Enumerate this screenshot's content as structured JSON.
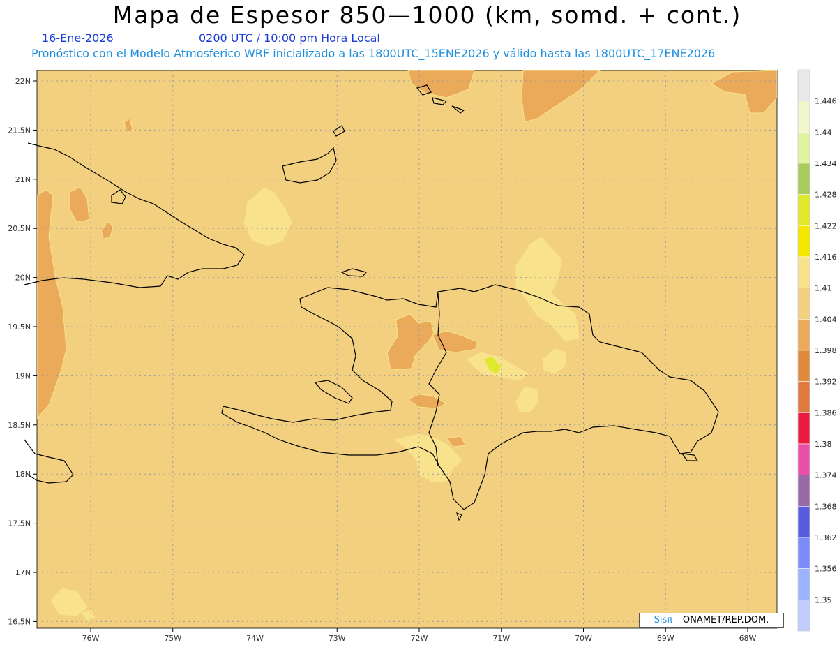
{
  "header": {
    "title": "Mapa de Espesor 850—1000 (km, somd. + cont.)",
    "date": "16-Ene-2026",
    "time": "0200 UTC / 10:00 pm Hora Local",
    "forecast": "Pronóstico con el Modelo Atmosferico WRF inicializado a las 1800UTC_15ENE2026 y válido hasta las  1800UTC_17ENE2026"
  },
  "axes": {
    "lat_ticks": [
      "22N",
      "21.5N",
      "21N",
      "20.5N",
      "20N",
      "19.5N",
      "19N",
      "18.5N",
      "18N",
      "17.5N",
      "17N",
      "16.5N"
    ],
    "lon_ticks": [
      "76W",
      "75W",
      "74W",
      "73W",
      "72W",
      "71W",
      "70W",
      "69W",
      "68W"
    ]
  },
  "legend": {
    "labels": [
      "1.446",
      "1.44",
      "1.434",
      "1.428",
      "1.422",
      "1.416",
      "1.41",
      "1.404",
      "1.398",
      "1.392",
      "1.386",
      "1.38",
      "1.374",
      "1.368",
      "1.362",
      "1.356",
      "1.35"
    ],
    "colors": [
      "#e8e8e8",
      "#f0f5cc",
      "#dff3a0",
      "#a8cc5c",
      "#dfe82a",
      "#f5e600",
      "#f8e38c",
      "#f3cf80",
      "#eba95a",
      "#e08a3c",
      "#df7a3e",
      "#eb1a3f",
      "#e850a8",
      "#9a6aa8",
      "#5a5ae0",
      "#7b8cfa",
      "#9cb4ff",
      "#c0ccff"
    ]
  },
  "credit": {
    "brand": "Sisπ",
    "org": "– ONAMET/REP.DOM."
  },
  "colors": {
    "background_fill": "#f3cf80",
    "warm_fill": "#eba95a",
    "cool_fill": "#f8e38c",
    "coast": "#000000"
  }
}
